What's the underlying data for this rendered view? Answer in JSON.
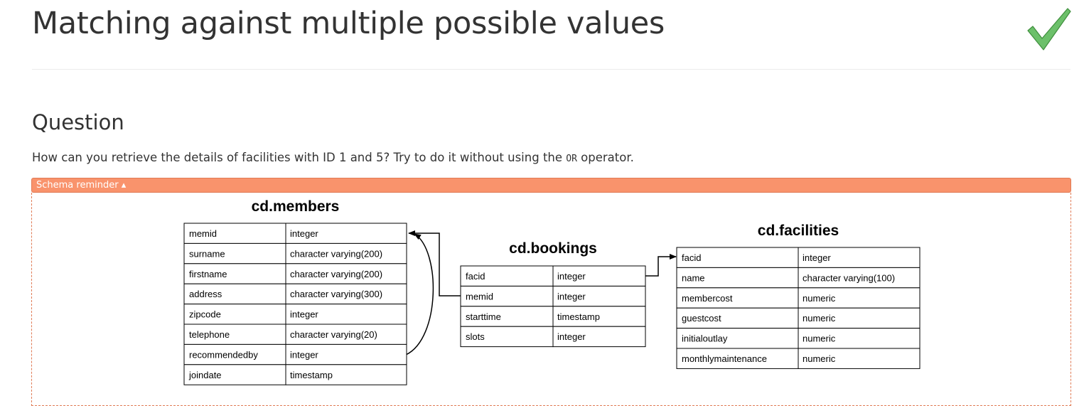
{
  "page": {
    "title": "Matching against multiple possible values",
    "status_icon": "checkmark-icon",
    "status_color": "#5cb85c"
  },
  "question": {
    "heading": "Question",
    "text_before": "How can you retrieve the details of facilities with ID 1 and 5? Try to do it without using the ",
    "code": "OR",
    "text_after": " operator."
  },
  "schema": {
    "toggle_label": "Schema reminder ▴",
    "accent_color": "#f9936c",
    "tables": [
      {
        "name": "cd.members",
        "columns": [
          {
            "name": "memid",
            "type": "integer"
          },
          {
            "name": "surname",
            "type": "character varying(200)"
          },
          {
            "name": "firstname",
            "type": "character varying(200)"
          },
          {
            "name": "address",
            "type": "character varying(300)"
          },
          {
            "name": "zipcode",
            "type": "integer"
          },
          {
            "name": "telephone",
            "type": "character varying(20)"
          },
          {
            "name": "recommendedby",
            "type": "integer"
          },
          {
            "name": "joindate",
            "type": "timestamp"
          }
        ]
      },
      {
        "name": "cd.bookings",
        "columns": [
          {
            "name": "facid",
            "type": "integer"
          },
          {
            "name": "memid",
            "type": "integer"
          },
          {
            "name": "starttime",
            "type": "timestamp"
          },
          {
            "name": "slots",
            "type": "integer"
          }
        ]
      },
      {
        "name": "cd.facilities",
        "columns": [
          {
            "name": "facid",
            "type": "integer"
          },
          {
            "name": "name",
            "type": "character varying(100)"
          },
          {
            "name": "membercost",
            "type": "numeric"
          },
          {
            "name": "guestcost",
            "type": "numeric"
          },
          {
            "name": "initialoutlay",
            "type": "numeric"
          },
          {
            "name": "monthlymaintenance",
            "type": "numeric"
          }
        ]
      }
    ]
  }
}
